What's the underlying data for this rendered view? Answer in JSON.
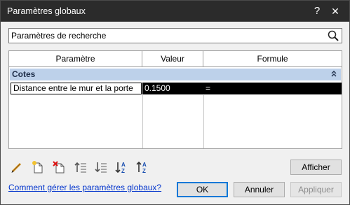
{
  "window": {
    "title": "Paramètres globaux",
    "help": "?",
    "close": "✕"
  },
  "search": {
    "value": "Paramètres de recherche"
  },
  "table": {
    "headers": [
      "Paramètre",
      "Valeur",
      "Formule"
    ],
    "groups": [
      {
        "label": "Cotes",
        "rows": [
          {
            "name": "Distance entre le mur et la porte",
            "value": "0.1500",
            "formula": "="
          }
        ]
      }
    ]
  },
  "toolbar": {
    "icons": [
      "pencil-edit-icon",
      "new-parameter-icon",
      "delete-parameter-icon",
      "move-up-icon",
      "move-down-icon",
      "sort-ascending-icon",
      "sort-descending-icon"
    ]
  },
  "buttons": {
    "show": "Afficher",
    "ok": "OK",
    "cancel": "Annuler",
    "apply": "Appliquer"
  },
  "help_link": "Comment gérer les paramètres globaux?",
  "colors": {
    "titlebar": "#2b2b2b",
    "group_row": "#bdd1ea",
    "selection": "#000000",
    "link": "#0033cc"
  }
}
